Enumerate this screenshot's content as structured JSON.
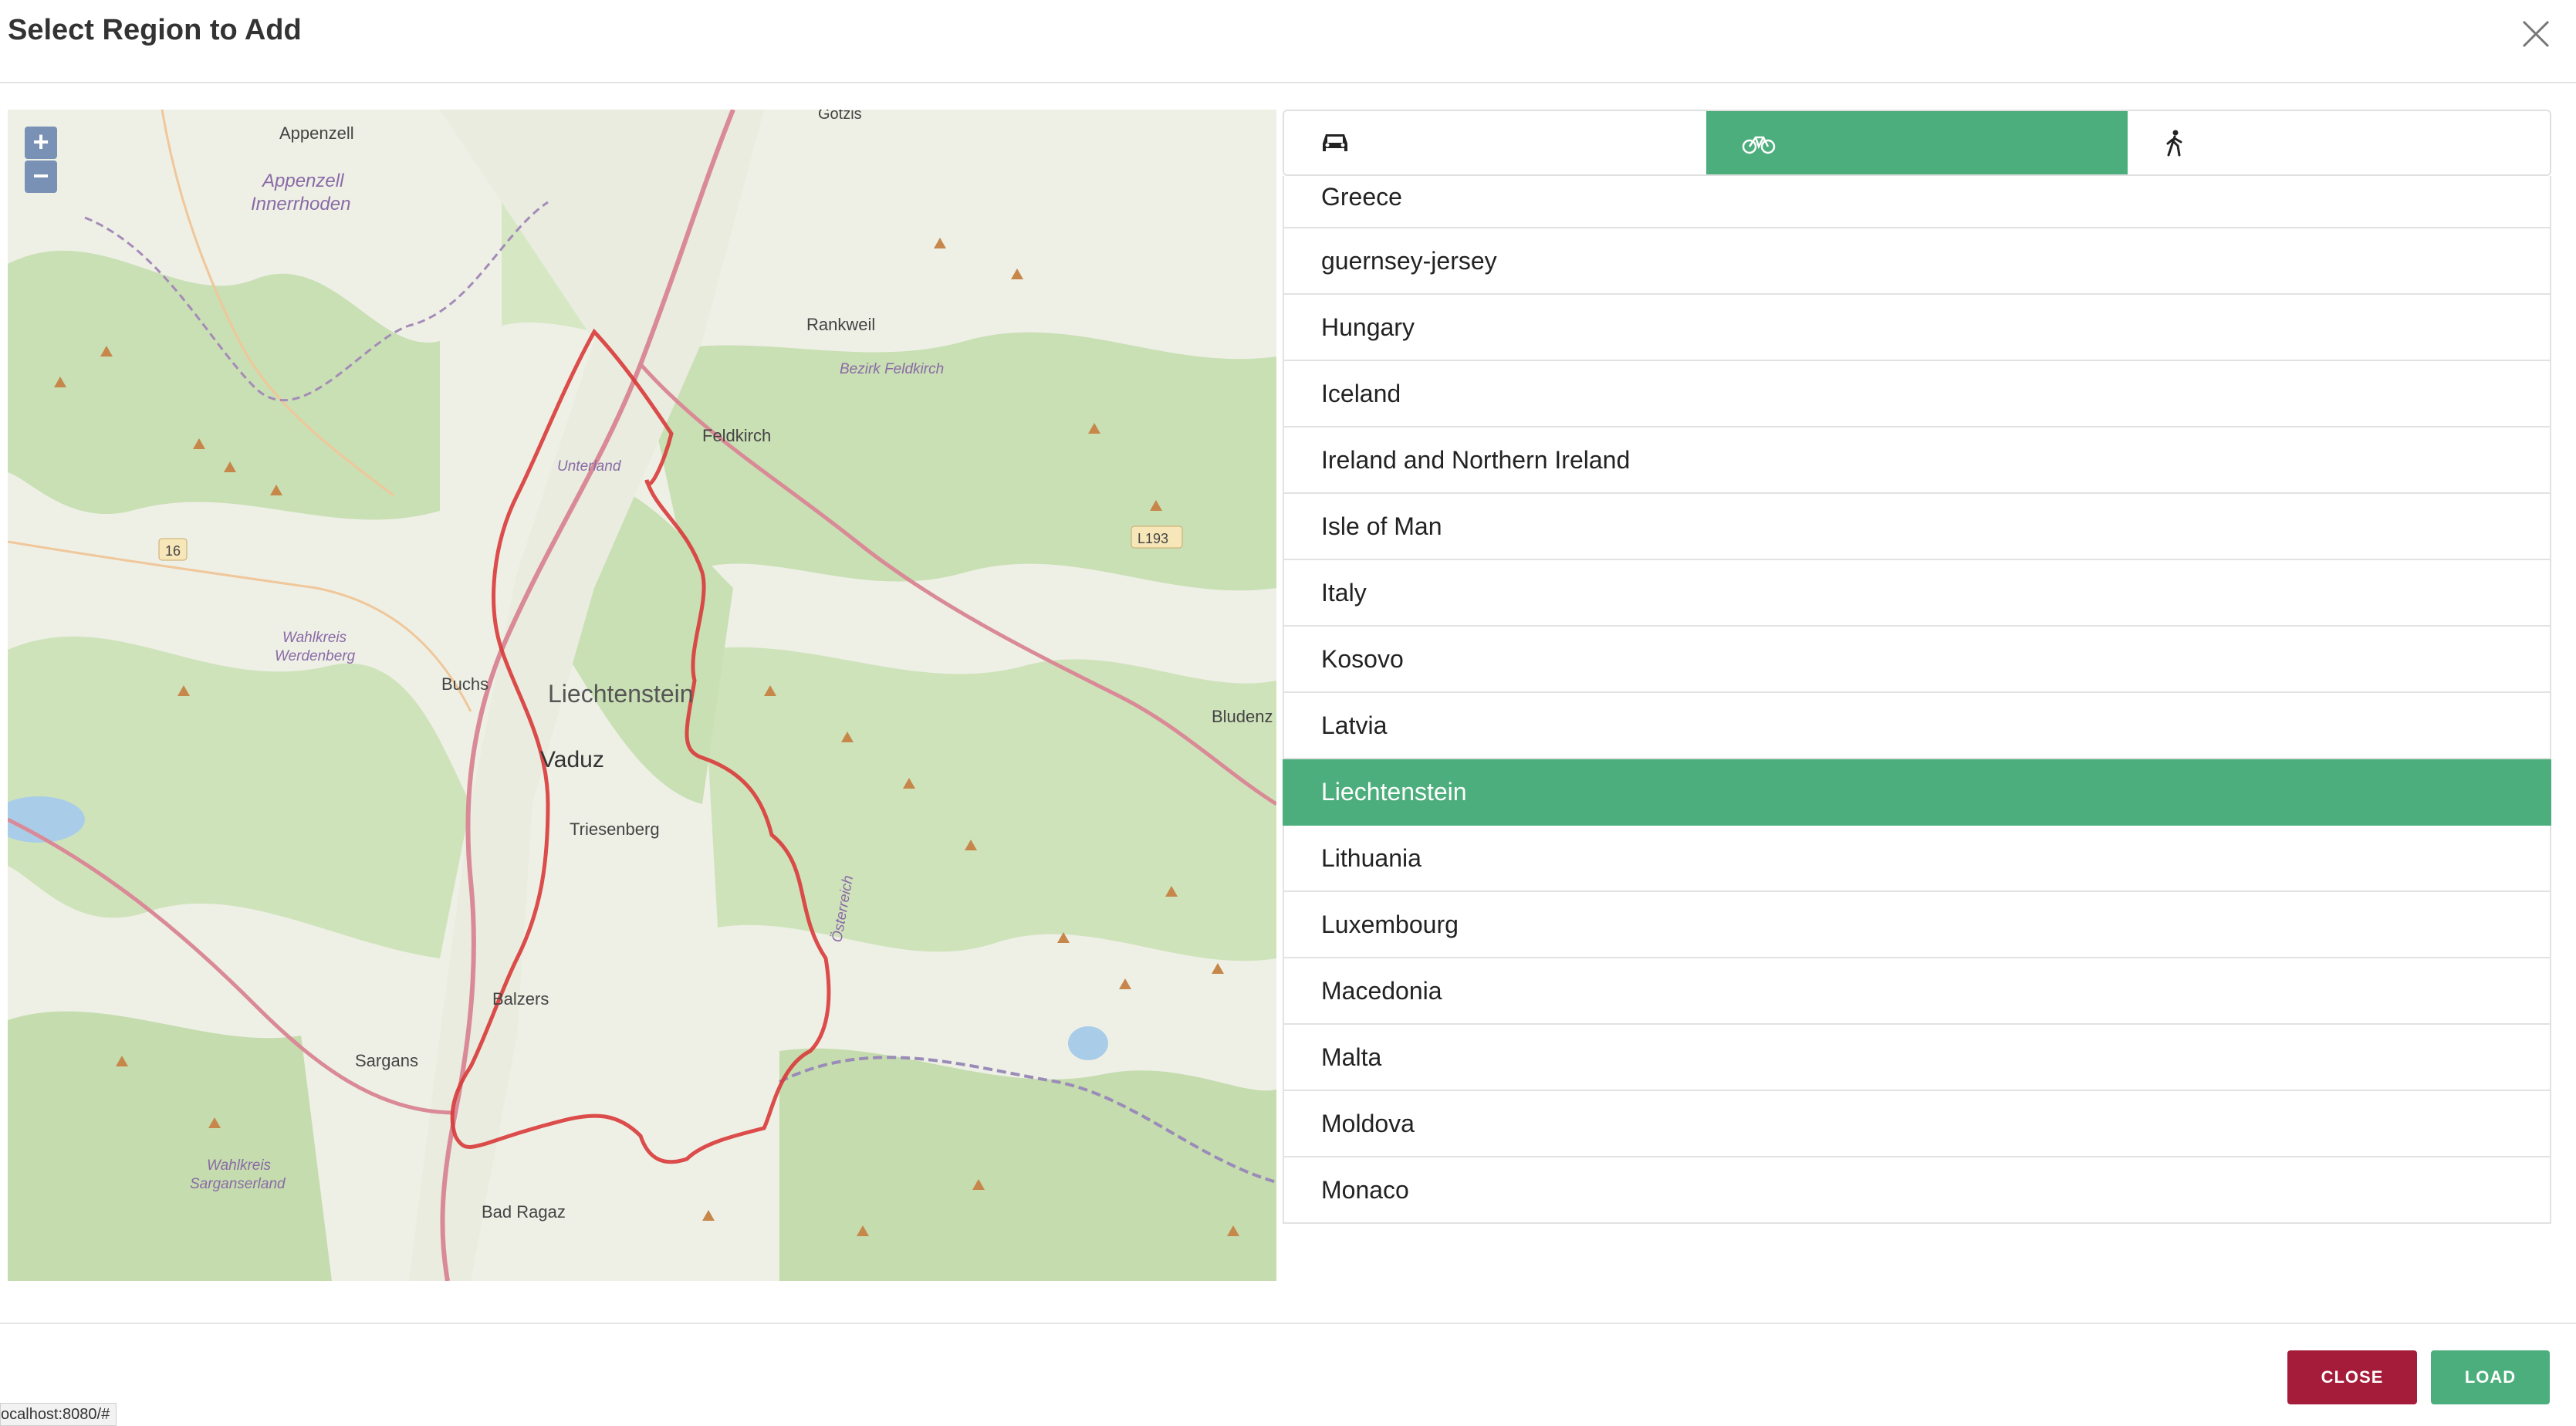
{
  "dialog": {
    "title": "Select Region to Add"
  },
  "map": {
    "zoom_in": "+",
    "zoom_out": "−",
    "labels": {
      "goetzis": "Götzis",
      "appenzell": "Appenzell",
      "appenzell_inner_1": "Appenzell",
      "appenzell_inner_2": "Innerrhoden",
      "rankweil": "Rankweil",
      "bezirk_feldkirch": "Bezirk Feldkirch",
      "feldkirch": "Feldkirch",
      "unterland": "Unterland",
      "road_16": "16",
      "road_l193": "L193",
      "wahlkreis_werdenberg_1": "Wahlkreis",
      "wahlkreis_werdenberg_2": "Werdenberg",
      "buchs": "Buchs",
      "liechtenstein": "Liechtenstein",
      "vaduz": "Vaduz",
      "triesenberg": "Triesenberg",
      "bludenz": "Bludenz",
      "oesterreich": "Österreich",
      "balzers": "Balzers",
      "sargans": "Sargans",
      "wahlkreis_sargans_1": "Wahlkreis",
      "wahlkreis_sargans_2": "Sarganserland",
      "bad_ragaz": "Bad Ragaz"
    }
  },
  "tabs": [
    {
      "icon": "car-icon",
      "active": false
    },
    {
      "icon": "bicycle-icon",
      "active": true
    },
    {
      "icon": "walking-icon",
      "active": false
    }
  ],
  "regions": [
    "Greece",
    "guernsey-jersey",
    "Hungary",
    "Iceland",
    "Ireland and Northern Ireland",
    "Isle of Man",
    "Italy",
    "Kosovo",
    "Latvia",
    "Liechtenstein",
    "Lithuania",
    "Luxembourg",
    "Macedonia",
    "Malta",
    "Moldova",
    "Monaco"
  ],
  "selected_region": "Liechtenstein",
  "buttons": {
    "close": "CLOSE",
    "load": "LOAD"
  },
  "status_bar": "ocalhost:8080/#",
  "colors": {
    "accent": "#4cae7c",
    "danger": "#a51c3b"
  }
}
